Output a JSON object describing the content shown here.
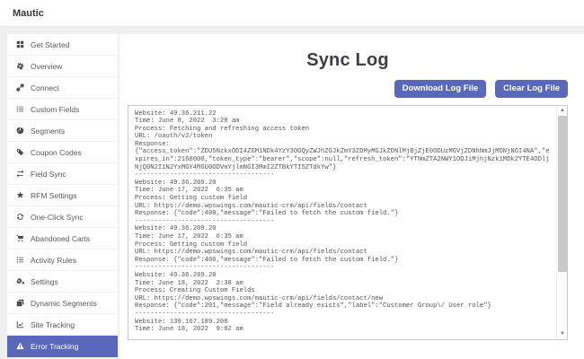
{
  "colors": {
    "accent": "#5a68bb",
    "button_text": "#ffffff"
  },
  "topbar": {
    "brand": "Mautic"
  },
  "sidebar": {
    "items": [
      {
        "icon": "grid-icon",
        "label": "Get Started",
        "active": false
      },
      {
        "icon": "gear-icon",
        "label": "Overview",
        "active": false
      },
      {
        "icon": "link-icon",
        "label": "Connect",
        "active": false
      },
      {
        "icon": "list-icon",
        "label": "Custom Fields",
        "active": false
      },
      {
        "icon": "pie-chart-icon",
        "label": "Segments",
        "active": false
      },
      {
        "icon": "tag-icon",
        "label": "Coupon Codes",
        "active": false
      },
      {
        "icon": "swap-arrows-icon",
        "label": "Field Sync",
        "active": false
      },
      {
        "icon": "star-icon",
        "label": "RFM Settings",
        "active": false
      },
      {
        "icon": "sync-icon",
        "label": "One-Click Sync",
        "active": false
      },
      {
        "icon": "cart-icon",
        "label": "Abandoned Carts",
        "active": false
      },
      {
        "icon": "list-icon",
        "label": "Activity Rules",
        "active": false
      },
      {
        "icon": "cogs-icon",
        "label": "Settings",
        "active": false
      },
      {
        "icon": "copy-icon",
        "label": "Dynamic Segments",
        "active": false
      },
      {
        "icon": "chart-line-icon",
        "label": "Site Tracking",
        "active": false
      },
      {
        "icon": "warning-icon",
        "label": "Error Tracking",
        "active": true
      }
    ]
  },
  "main": {
    "title": "Sync Log",
    "buttons": {
      "download": "Download Log File",
      "clear": "Clear Log File"
    },
    "log_content": "Website: 49.36.211.22\nTime: June 8, 2022  3:28 am\nProcess: Fetching and refreshing access token\nURL: /oauth/v2/token\nResponse:\n{\"access_token\":\"ZDU5NzkxODI4ZGM1NDk4YzY3OGQyZWJhZGJkZmY3ZDMyMGJkZDNlMjBjZjE0ODUzMGVjZDNhNmJjMDNjNGI4NA\",\"e\nxpires_in\":2160000,\"token_type\":\"bearer\",\"scope\":null,\"refresh_token\":\"YTNmZTA2NWY1ODJiMjhjNzk1MDk2YTE4ODlj\nNjQ0N2I1N2YxMGY4MGU0ODVmYjlmNGI3MmI2ZTBkYTI5ZTdkYw\"}\n------------------------------------\nWebsite: 49.36.209.20\nTime: June 17, 2022  6:35 am\nProcess: Getting custom field\nURL: https://demo.wpswings.com/mautic-crm/api/fields/contact\nResponse: {\"code\":400,\"message\":\"Failed to fetch the custom field.\"}\n------------------------------------\nWebsite: 49.36.209.20\nTime: June 17, 2022  6:35 am\nProcess: Getting custom field\nURL: https://demo.wpswings.com/mautic-crm/api/fields/contact\nResponse: {\"code\":400,\"message\":\"Failed to fetch the custom field.\"}\n------------------------------------\nWebsite: 49.36.209.20\nTime: June 18, 2022  2:38 am\nProcess: Creating Custom Fields\nURL: https://demo.wpswings.com/mautic-crm/api/fields/contact/new\nResponse: {\"code\":201,\"message\":\"Field already exists\",\"label\":\"Customer Group\\/ User role\"}\n------------------------------------\nWebsite: 139.167.189.208\nTime: June 18, 2022  9:02 am",
    "scrollbar": {
      "up_glyph": "▲",
      "down_glyph": "▼"
    }
  }
}
